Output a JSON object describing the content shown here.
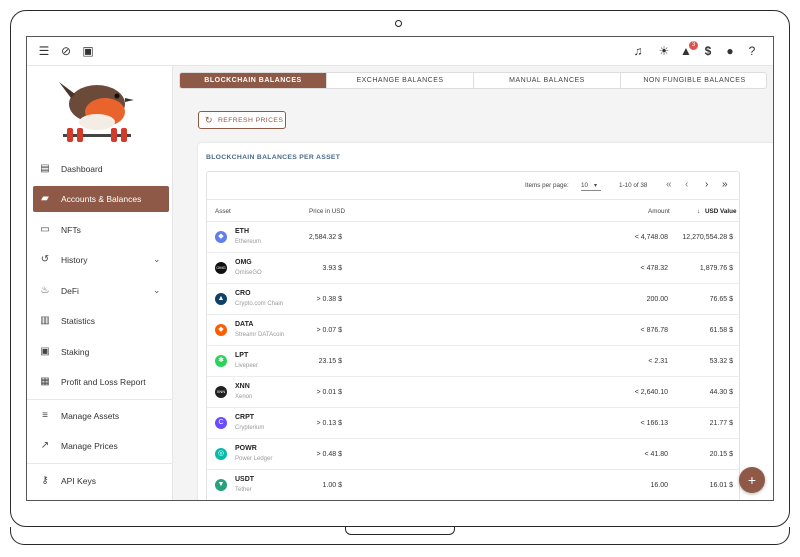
{
  "appbar": {
    "icons": [
      "menu-icon",
      "link-off-icon",
      "save-icon",
      "music-note-icon",
      "sun-icon",
      "bell-icon",
      "dollar-icon",
      "account-icon",
      "help-icon"
    ],
    "notification_count": "3"
  },
  "sidebar": {
    "items": [
      {
        "label": "Dashboard",
        "icon": "dashboard-icon"
      },
      {
        "label": "Accounts & Balances",
        "icon": "briefcase-icon"
      },
      {
        "label": "NFTs",
        "icon": "image-icon"
      },
      {
        "label": "History",
        "icon": "history-icon"
      },
      {
        "label": "DeFi",
        "icon": "defi-icon"
      },
      {
        "label": "Statistics",
        "icon": "bar-chart-icon"
      },
      {
        "label": "Staking",
        "icon": "staking-icon"
      },
      {
        "label": "Profit and Loss Report",
        "icon": "calculator-icon"
      },
      {
        "label": "Manage Assets",
        "icon": "assets-icon"
      },
      {
        "label": "Manage Prices",
        "icon": "trend-icon"
      },
      {
        "label": "API Keys",
        "icon": "key-icon"
      }
    ]
  },
  "tabs": [
    "BLOCKCHAIN BALANCES",
    "EXCHANGE BALANCES",
    "MANUAL BALANCES",
    "NON FUNGIBLE BALANCES"
  ],
  "refresh_label": "REFRESH PRICES",
  "card_title": "BLOCKCHAIN BALANCES PER ASSET",
  "pager": {
    "items_per_page_label": "Items per page:",
    "items_per_page": "10",
    "range": "1-10 of 38"
  },
  "table": {
    "headers": {
      "asset": "Asset",
      "price": "Price in USD",
      "amount": "Amount",
      "value": "USD Value"
    },
    "rows": [
      {
        "symbol": "ETH",
        "name": "Ethereum",
        "price": "2,584.32 $",
        "amount": "< 4,748.08",
        "value": "12,270,554.28 $",
        "color": "#627eea",
        "glyph": "◆"
      },
      {
        "symbol": "OMG",
        "name": "OmiseGO",
        "price": "3.93 $",
        "amount": "< 478.32",
        "value": "1,879.76 $",
        "color": "#101010",
        "glyph": "OMG"
      },
      {
        "symbol": "CRO",
        "name": "Crypto.com Chain",
        "price": "> 0.38 $",
        "amount": "200.00",
        "value": "76.65 $",
        "color": "#103f68",
        "glyph": "▲"
      },
      {
        "symbol": "DATA",
        "name": "Streamr DATAcoin",
        "price": "> 0.07 $",
        "amount": "< 876.78",
        "value": "61.58 $",
        "color": "#ff5c00",
        "glyph": "◆"
      },
      {
        "symbol": "LPT",
        "name": "Livepeer",
        "price": "23.15 $",
        "amount": "< 2.31",
        "value": "53.32 $",
        "color": "#2cd35a",
        "glyph": "✱"
      },
      {
        "symbol": "XNN",
        "name": "Xenon",
        "price": "> 0.01 $",
        "amount": "< 2,640.10",
        "value": "44.30 $",
        "color": "#202020",
        "glyph": "XNN"
      },
      {
        "symbol": "CRPT",
        "name": "Crypterium",
        "price": "> 0.13 $",
        "amount": "< 166.13",
        "value": "21.77 $",
        "color": "#6a4cff",
        "glyph": "C"
      },
      {
        "symbol": "POWR",
        "name": "Power Ledger",
        "price": "> 0.48 $",
        "amount": "< 41.80",
        "value": "20.15 $",
        "color": "#05bca9",
        "glyph": "◎"
      },
      {
        "symbol": "USDT",
        "name": "Tether",
        "price": "1.00 $",
        "amount": "16.00",
        "value": "16.01 $",
        "color": "#26a17b",
        "glyph": "▼"
      }
    ]
  },
  "colors": {
    "accent": "#8e5a47"
  }
}
